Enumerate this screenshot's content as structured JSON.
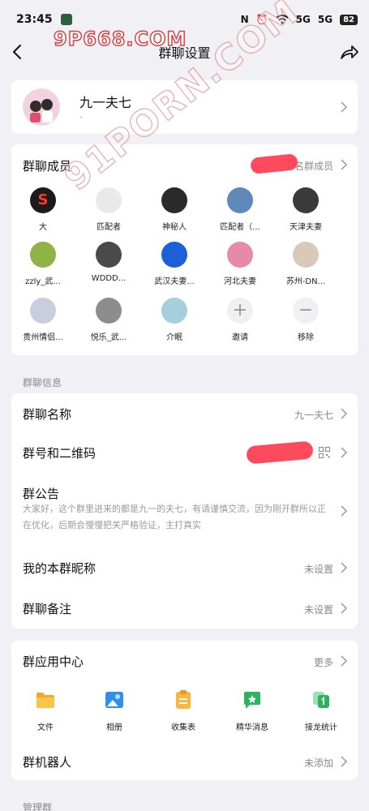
{
  "status": {
    "time": "23:45",
    "indicators": [
      "N",
      "⏰",
      "5G",
      "5G"
    ],
    "battery": "82"
  },
  "nav": {
    "title": "群聊设置"
  },
  "watermarks": {
    "top": "9P668.COM",
    "diagonal": "91PORN.COM"
  },
  "group": {
    "name": "九一夫七",
    "subtitle": "-"
  },
  "members": {
    "header": "群聊成员",
    "count_label": "名群成员",
    "items": [
      {
        "name": "大",
        "color": "#1b1b1b",
        "glyph": "S",
        "glyph_color": "#ff3a2a"
      },
      {
        "name": "匹配者",
        "color": "#e9e9e9",
        "glyph": "",
        "glyph_color": "#333"
      },
      {
        "name": "神秘人",
        "color": "#2a2a2a",
        "glyph": "",
        "glyph_color": "#fff"
      },
      {
        "name": "匹配者（...",
        "color": "#5f87b8",
        "glyph": "",
        "glyph_color": "#fff"
      },
      {
        "name": "天津夫妻",
        "color": "#3a3a3a",
        "glyph": "",
        "glyph_color": "#fff"
      },
      {
        "name": "zzly_武...",
        "color": "#8fb347",
        "glyph": "",
        "glyph_color": "#fff"
      },
      {
        "name": "WDDD...",
        "color": "#4a4a4a",
        "glyph": "",
        "glyph_color": "#fff"
      },
      {
        "name": "武汉夫妻...",
        "color": "#1d5fd6",
        "glyph": "",
        "glyph_color": "#fff"
      },
      {
        "name": "河北夫妻",
        "color": "#e68aa7",
        "glyph": "",
        "glyph_color": "#fff"
      },
      {
        "name": "苏州-DN...",
        "color": "#d9c9b8",
        "glyph": "",
        "glyph_color": "#fff"
      },
      {
        "name": "贵州情侣...",
        "color": "#c8cde0",
        "glyph": "",
        "glyph_color": "#fff"
      },
      {
        "name": "悦乐_武...",
        "color": "#8d8d8d",
        "glyph": "",
        "glyph_color": "#fff"
      },
      {
        "name": "介眠",
        "color": "#a6cfdc",
        "glyph": "",
        "glyph_color": "#fff"
      }
    ],
    "actions": [
      {
        "label": "邀请",
        "symbol": "+"
      },
      {
        "label": "移除",
        "symbol": "−"
      }
    ]
  },
  "info": {
    "section_title": "群聊信息",
    "name_label": "群聊名称",
    "name_value": "九一夫七",
    "qr_label": "群号和二维码",
    "announce_label": "群公告",
    "announce_text": "大家好，这个群里进来的都是九一的夫七，有请谨慎交流，因为刚开群所以正在优化，后期会慢慢把关严格验证，主打真实",
    "nickname_label": "我的本群昵称",
    "nickname_value": "未设置",
    "remark_label": "群聊备注",
    "remark_value": "未设置"
  },
  "apps": {
    "header": "群应用中心",
    "more": "更多",
    "items": [
      {
        "label": "文件",
        "color": "#f6a623"
      },
      {
        "label": "相册",
        "color": "#2f8ef0"
      },
      {
        "label": "收集表",
        "color": "#f6b73c"
      },
      {
        "label": "精华消息",
        "color": "#27b65d"
      },
      {
        "label": "接龙统计",
        "color": "#28b35c"
      }
    ],
    "robot_label": "群机器人",
    "robot_value": "未添加"
  },
  "manage": {
    "section_title": "管理群"
  }
}
